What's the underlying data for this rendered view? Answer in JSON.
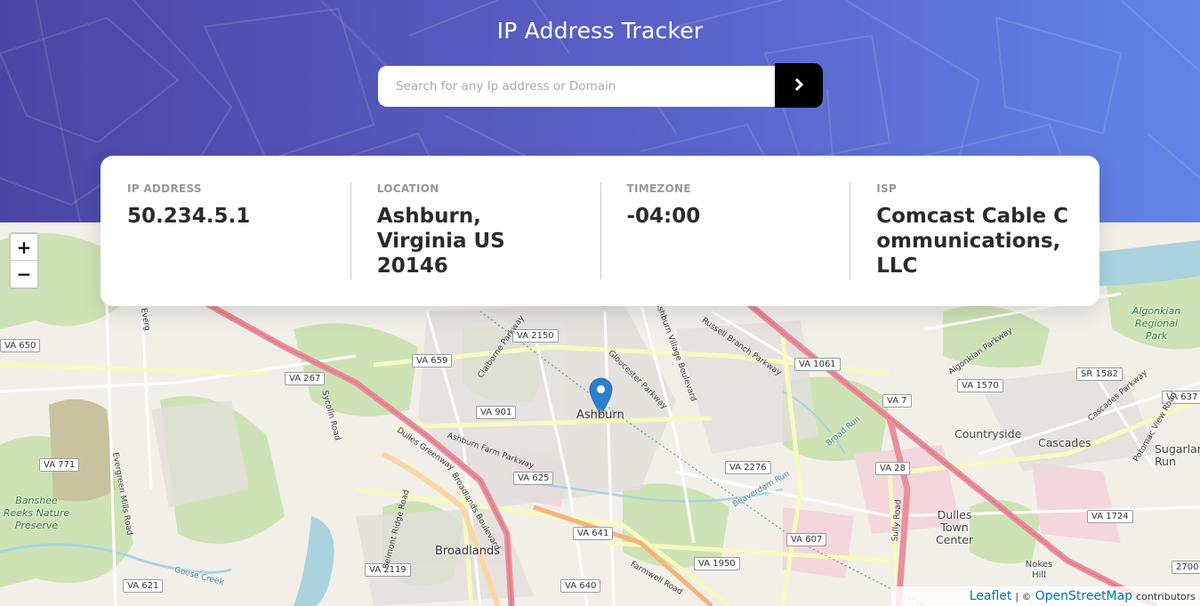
{
  "header": {
    "title": "IP Address Tracker"
  },
  "search": {
    "placeholder": "Search for any Ip address or Domain",
    "value": ""
  },
  "info": [
    {
      "label": "IP ADDRESS",
      "value": "50.234.5.1"
    },
    {
      "label": "LOCATION",
      "value": "Ashburn, Virginia US 20146"
    },
    {
      "label": "TIMEZONE",
      "value": "-04:00"
    },
    {
      "label": "ISP",
      "value": "Comcast Cable Communications, LLC"
    }
  ],
  "map": {
    "zoom_in": "+",
    "zoom_out": "−",
    "marker_place": "Ashburn",
    "places": [
      "Countryside",
      "Cascades",
      "Sugarland Run",
      "Dulles Town Center",
      "Broadlands",
      "Nokes Hill"
    ],
    "parks": [
      "Algonkian Regional Park",
      "Banshee Reeks Nature Preserve"
    ],
    "roads": [
      "VA 650",
      "VA 267",
      "VA 659",
      "VA 2150",
      "VA 901",
      "VA 1061",
      "VA 1570",
      "SR 1582",
      "VA 637",
      "VA 7",
      "VA 771",
      "VA 625",
      "VA 2276",
      "VA 28",
      "VA 1724",
      "VA 641",
      "VA 607",
      "VA 2119",
      "VA 1950",
      "VA 621",
      "VA 640",
      "2700"
    ],
    "street_names": [
      "Everg",
      "Sycolin Road",
      "Dulles Greenway",
      "Ashburn Farm Parkway",
      "Claiborne Parkway",
      "Gloucester Parkway",
      "Ashburn Village Boulevard",
      "Russell Branch Parkway",
      "Broad Run",
      "Beaverdam Run",
      "Belmont Ridge Road",
      "Broadlands Boulevard",
      "Farmwell Road",
      "Evergreen Mills Road",
      "Goose Creek",
      "Algonkian Parkway",
      "Cascades Parkway",
      "Potomac View Road",
      "Sully Road"
    ]
  },
  "attribution": {
    "leaflet": "Leaflet",
    "separator": "| ©",
    "osm": "OpenStreetMap",
    "suffix": "contributors"
  },
  "colors": {
    "accent": "#000000",
    "header_start": "#4c45a5",
    "header_end": "#6284e6",
    "marker": "#2a81cb",
    "major_road": "#e8909c",
    "text_dark": "#2b2b2b",
    "label_gray": "#979797"
  }
}
